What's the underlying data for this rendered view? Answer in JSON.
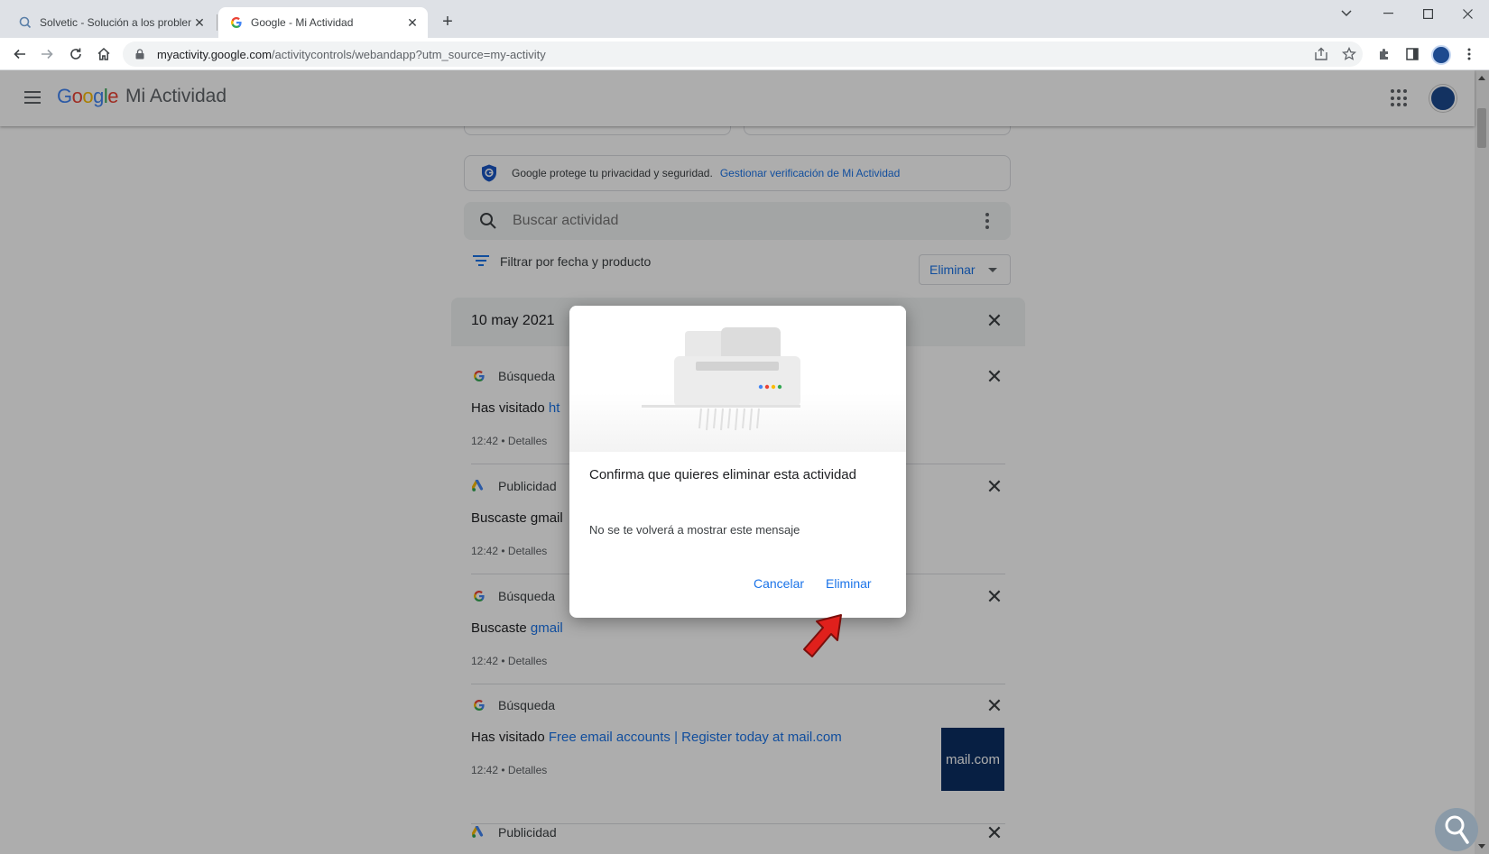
{
  "browser": {
    "tabs": [
      {
        "title": "Solvetic - Solución a los problem",
        "active": false
      },
      {
        "title": "Google - Mi Actividad",
        "active": true
      }
    ],
    "new_tab": "+",
    "url_host": "myactivity.google.com",
    "url_path": "/activitycontrols/webandapp?utm_source=my-activity"
  },
  "header": {
    "logo": "Google",
    "product": "Mi Actividad"
  },
  "privacy": {
    "text": "Google protege tu privacidad y seguridad.",
    "link": "Gestionar verificación de Mi Actividad"
  },
  "search": {
    "placeholder": "Buscar actividad"
  },
  "filter": {
    "label": "Filtrar por fecha y producto",
    "delete_label": "Eliminar"
  },
  "day": {
    "title": "10 may 2021"
  },
  "items": [
    {
      "product": "Búsqueda",
      "prefix": "Has visitado",
      "link": "ht",
      "time": "12:42",
      "details": "Detalles"
    },
    {
      "product": "Publicidad",
      "prefix": "Buscaste gmail",
      "link": "",
      "time": "12:42",
      "details": "Detalles"
    },
    {
      "product": "Búsqueda",
      "prefix": "Buscaste",
      "link": "gmail",
      "time": "12:42",
      "details": "Detalles"
    },
    {
      "product": "Búsqueda",
      "prefix": "Has visitado",
      "link": "Free email accounts | Register today at mail.com",
      "time": "12:42",
      "details": "Detalles",
      "thumb": "mail.com"
    },
    {
      "product": "Publicidad"
    }
  ],
  "dialog": {
    "title": "Confirma que quieres eliminar esta actividad",
    "message": "No se te volverá a mostrar este mensaje",
    "cancel": "Cancelar",
    "confirm": "Eliminar"
  },
  "colors": {
    "accent": "#1a73e8",
    "arrow": "#e0201c",
    "scrim": "#000000"
  }
}
